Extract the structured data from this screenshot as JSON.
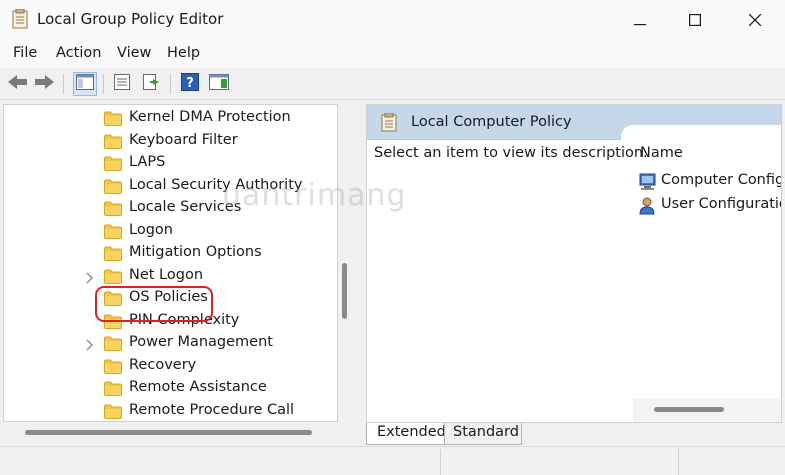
{
  "window": {
    "title": "Local Group Policy Editor",
    "controls": {
      "minimize": "minimize",
      "maximize": "maximize",
      "close": "close"
    }
  },
  "menu": {
    "items": [
      {
        "label": "File"
      },
      {
        "label": "Action"
      },
      {
        "label": "View"
      },
      {
        "label": "Help"
      }
    ]
  },
  "toolbar": {
    "buttons": [
      "back-icon",
      "forward-icon",
      "show-hide-tree-icon",
      "properties-icon",
      "export-list-icon",
      "help-icon",
      "show-action-pane-icon"
    ]
  },
  "tree": {
    "items": [
      {
        "label": "Kernel DMA Protection",
        "expandable": false
      },
      {
        "label": "Keyboard Filter",
        "expandable": false
      },
      {
        "label": "LAPS",
        "expandable": false
      },
      {
        "label": "Local Security Authority",
        "expandable": false
      },
      {
        "label": "Locale Services",
        "expandable": false
      },
      {
        "label": "Logon",
        "expandable": false
      },
      {
        "label": "Mitigation Options",
        "expandable": false
      },
      {
        "label": "Net Logon",
        "expandable": true
      },
      {
        "label": "OS Policies",
        "expandable": false,
        "highlighted": true
      },
      {
        "label": "PIN Complexity",
        "expandable": false
      },
      {
        "label": "Power Management",
        "expandable": true
      },
      {
        "label": "Recovery",
        "expandable": false
      },
      {
        "label": "Remote Assistance",
        "expandable": false
      },
      {
        "label": "Remote Procedure Call",
        "expandable": false
      }
    ]
  },
  "right_pane": {
    "header": "Local Computer Policy",
    "description": "Select an item to view its description.",
    "column_name": "Name",
    "items": [
      {
        "label": "Computer Configu"
      },
      {
        "label": "User Configuration"
      }
    ]
  },
  "tabs": [
    {
      "label": "Extended",
      "active": true
    },
    {
      "label": "Standard",
      "active": false
    }
  ],
  "watermark": "uantrimang",
  "colors": {
    "highlight": "#e02020",
    "header_bg": "#c5d8ea",
    "folder": "#f4c542"
  }
}
